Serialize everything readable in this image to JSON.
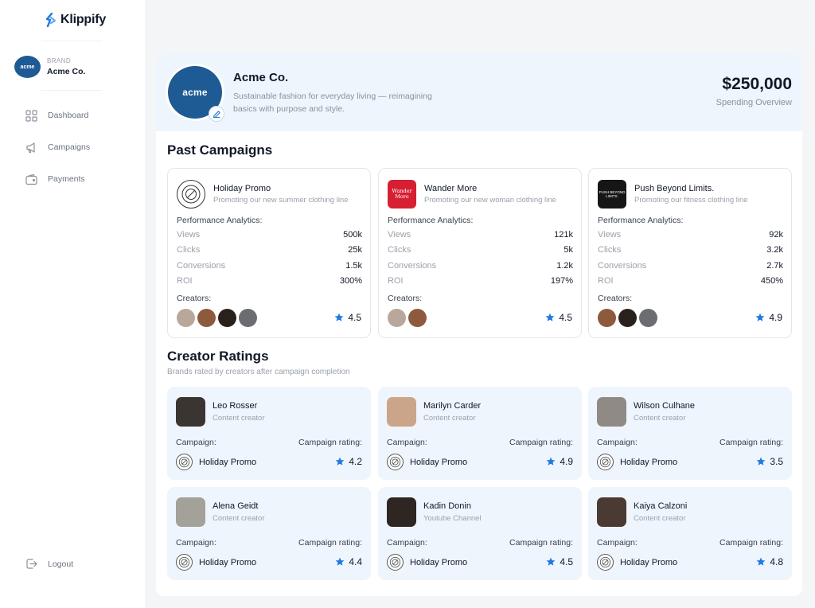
{
  "app": {
    "name": "Klippify"
  },
  "colors": {
    "accent": "#1f7ae0",
    "brand_blue": "#1e5a94",
    "card_tint": "#eef5fc"
  },
  "sidebar": {
    "brand_label": "BRAND",
    "brand_name": "Acme Co.",
    "brand_logo_text": "acme",
    "nav": [
      {
        "label": "Dashboard",
        "icon": "grid-icon"
      },
      {
        "label": "Campaigns",
        "icon": "megaphone-icon"
      },
      {
        "label": "Payments",
        "icon": "wallet-icon"
      }
    ],
    "logout_label": "Logout"
  },
  "profile": {
    "logo_text": "acme",
    "name": "Acme Co.",
    "description": "Sustainable fashion for everyday living — reimagining basics with purpose and style.",
    "spend_amount": "$250,000",
    "spend_label": "Spending Overview"
  },
  "past_campaigns": {
    "title": "Past Campaigns",
    "performance_label": "Performance Analytics:",
    "creators_label": "Creators:",
    "items": [
      {
        "name": "Holiday Promo",
        "description": "Promoting our new summer clothing line",
        "logo": "badge-icon",
        "metrics": [
          {
            "label": "Views",
            "value": "500k"
          },
          {
            "label": "Clicks",
            "value": "25k"
          },
          {
            "label": "Conversions",
            "value": "1.5k"
          },
          {
            "label": "ROI",
            "value": "300%"
          }
        ],
        "rating": "4.5",
        "creator_colors": [
          "#b9a79c",
          "#8d5a3e",
          "#2a211d",
          "#6b6d70"
        ]
      },
      {
        "name": "Wander More",
        "description": "Promoting our new woman clothing line",
        "logo_text": "Wander More",
        "metrics": [
          {
            "label": "Views",
            "value": "121k"
          },
          {
            "label": "Clicks",
            "value": "5k"
          },
          {
            "label": "Conversions",
            "value": "1.2k"
          },
          {
            "label": "ROI",
            "value": "197%"
          }
        ],
        "rating": "4.5",
        "creator_colors": [
          "#b9a79c",
          "#8d5a3e"
        ]
      },
      {
        "name": "Push Beyond Limits.",
        "description": "Promoting our fitness clothing line",
        "logo_text": "PUSH BEYOND LIMITS.",
        "metrics": [
          {
            "label": "Views",
            "value": "92k"
          },
          {
            "label": "Clicks",
            "value": "3.2k"
          },
          {
            "label": "Conversions",
            "value": "2.7k"
          },
          {
            "label": "ROI",
            "value": "450%"
          }
        ],
        "rating": "4.9",
        "creator_colors": [
          "#8d5a3e",
          "#2a211d",
          "#6b6d70"
        ]
      }
    ]
  },
  "creator_ratings": {
    "title": "Creator Ratings",
    "subtitle": "Brands rated by creators after campaign completion",
    "campaign_label": "Campaign:",
    "rating_label": "Campaign rating:",
    "items": [
      {
        "name": "Leo Rosser",
        "role": "Content creator",
        "campaign": "Holiday Promo",
        "rating": "4.2",
        "photo_color": "#3b3532"
      },
      {
        "name": "Marilyn Carder",
        "role": "Content creator",
        "campaign": "Holiday Promo",
        "rating": "4.9",
        "photo_color": "#caa58a"
      },
      {
        "name": "Wilson Culhane",
        "role": "Content creator",
        "campaign": "Holiday Promo",
        "rating": "3.5",
        "photo_color": "#8f8a86"
      },
      {
        "name": "Alena Geidt",
        "role": "Content creator",
        "campaign": "Holiday Promo",
        "rating": "4.4",
        "photo_color": "#a4a09a"
      },
      {
        "name": "Kadin Donin",
        "role": "Youtube Channel",
        "campaign": "Holiday Promo",
        "rating": "4.5",
        "photo_color": "#2e2622"
      },
      {
        "name": "Kaiya Calzoni",
        "role": "Content creator",
        "campaign": "Holiday Promo",
        "rating": "4.8",
        "photo_color": "#4a3a33"
      }
    ]
  }
}
